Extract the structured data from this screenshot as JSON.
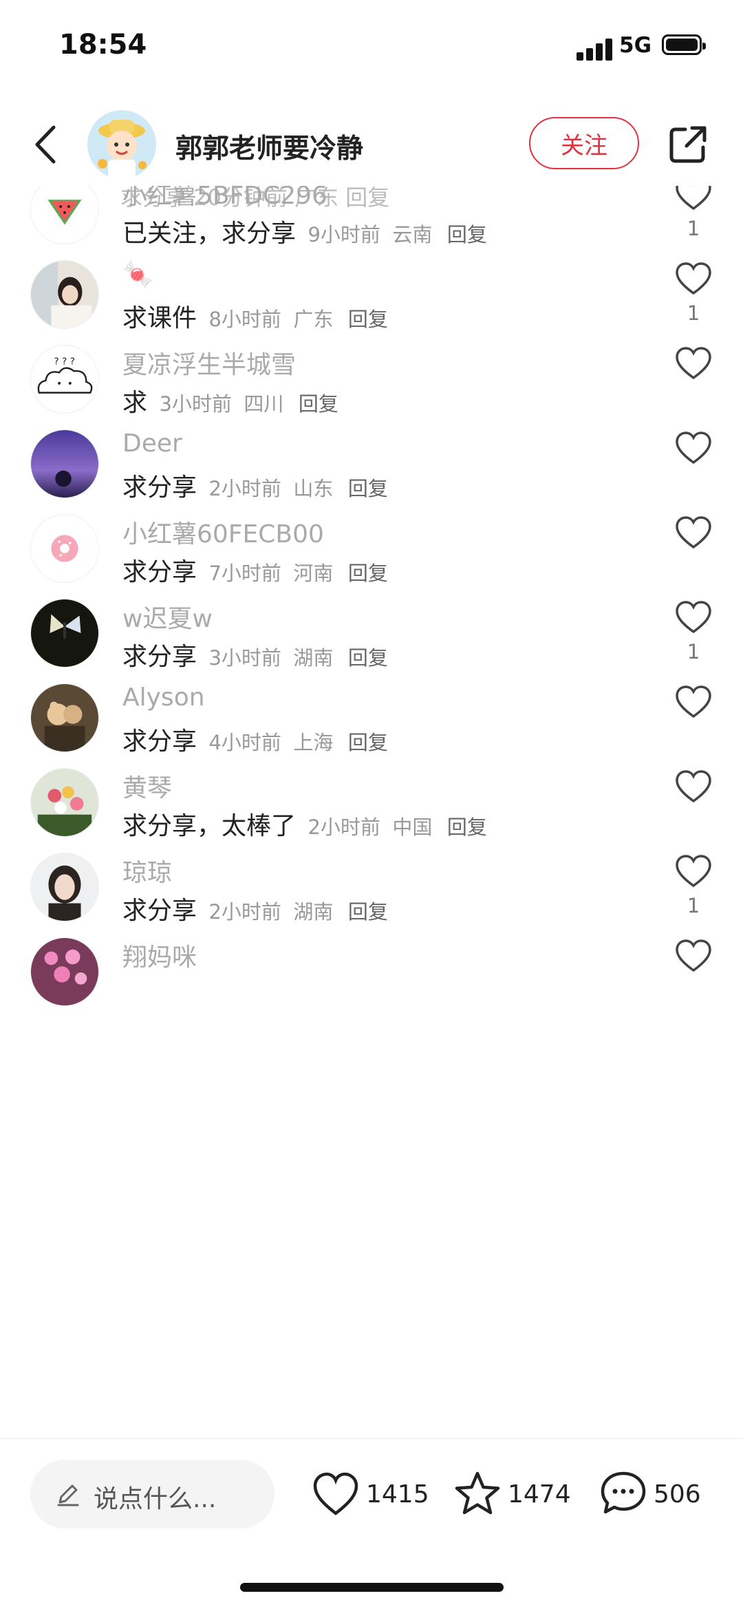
{
  "status": {
    "time": "18:54",
    "network": "5G"
  },
  "header": {
    "author": "郭郭老师要冷静",
    "follow_label": "关注"
  },
  "partial_text": "求分享 20分钟前 广东 回复",
  "comments": [
    {
      "user": "小红薯5BFDC296",
      "text": "已关注，求分享",
      "time": "9小时前",
      "location": "云南",
      "reply": "回复",
      "likes": "1",
      "avatar": "watermelon"
    },
    {
      "user": "🍬",
      "text": "求课件",
      "time": "8小时前",
      "location": "广东",
      "reply": "回复",
      "likes": "1",
      "avatar": "girl-photo"
    },
    {
      "user": "夏凉浮生半城雪",
      "text": "求",
      "time": "3小时前",
      "location": "四川",
      "reply": "回复",
      "likes": "",
      "avatar": "cloud-sketch"
    },
    {
      "user": "Deer",
      "text": "求分享",
      "time": "2小时前",
      "location": "山东",
      "reply": "回复",
      "likes": "",
      "avatar": "purple-sky"
    },
    {
      "user": "小红薯60FECB00",
      "text": "求分享",
      "time": "7小时前",
      "location": "河南",
      "reply": "回复",
      "likes": "",
      "avatar": "donut"
    },
    {
      "user": "w迟夏w",
      "text": "求分享",
      "time": "3小时前",
      "location": "湖南",
      "reply": "回复",
      "likes": "1",
      "avatar": "butterfly"
    },
    {
      "user": "Alyson",
      "text": "求分享",
      "time": "4小时前",
      "location": "上海",
      "reply": "回复",
      "likes": "",
      "avatar": "teddy-bear"
    },
    {
      "user": "黄琴",
      "text": "求分享，太棒了",
      "time": "2小时前",
      "location": "中国",
      "reply": "回复",
      "likes": "",
      "avatar": "flowers"
    },
    {
      "user": "琼琼",
      "text": "求分享",
      "time": "2小时前",
      "location": "湖南",
      "reply": "回复",
      "likes": "1",
      "avatar": "woman-portrait"
    },
    {
      "user": "翔妈咪",
      "text": "",
      "time": "",
      "location": "",
      "reply": "",
      "likes": "",
      "avatar": "pink-flowers"
    }
  ],
  "bottom": {
    "placeholder": "说点什么...",
    "likes": "1415",
    "favorites": "1474",
    "comments": "506"
  },
  "colors": {
    "accent": "#e0323f"
  }
}
